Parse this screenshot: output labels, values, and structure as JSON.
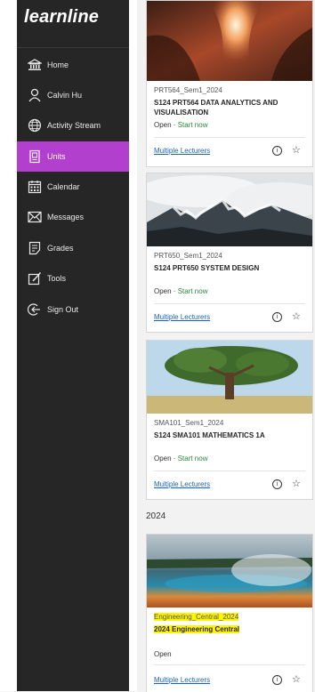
{
  "brand": {
    "logo_text": "learnline"
  },
  "sidebar": {
    "items": [
      {
        "label": "Home",
        "icon": "bank-icon"
      },
      {
        "label": "Calvin Hu",
        "icon": "user-icon"
      },
      {
        "label": "Activity Stream",
        "icon": "globe-icon"
      },
      {
        "label": "Units",
        "icon": "units-icon",
        "active": true
      },
      {
        "label": "Calendar",
        "icon": "calendar-icon"
      },
      {
        "label": "Messages",
        "icon": "mail-icon"
      },
      {
        "label": "Grades",
        "icon": "grades-icon"
      },
      {
        "label": "Tools",
        "icon": "tools-icon"
      },
      {
        "label": "Sign Out",
        "icon": "sign-out-icon"
      }
    ]
  },
  "units": [
    {
      "code": "PRT564_Sem1_2024",
      "title": "S124 PRT564 DATA ANALYTICS AND VISUALISATION",
      "status": "Open",
      "status_sep": " · ",
      "start_label": "Start now",
      "lecturers": "Multiple Lecturers",
      "info_icon": "info-icon",
      "star_icon": "star-icon",
      "image": "canyon-image"
    },
    {
      "code": "PRT650_Sem1_2024",
      "title": "S124 PRT650 SYSTEM DESIGN",
      "status": "Open",
      "status_sep": " · ",
      "start_label": "Start now",
      "lecturers": "Multiple Lecturers",
      "info_icon": "info-icon",
      "star_icon": "star-icon",
      "image": "mountain-image"
    },
    {
      "code": "SMA101_Sem1_2024",
      "title": "S124 SMA101 MATHEMATICS 1A",
      "status": "Open",
      "status_sep": " · ",
      "start_label": "Start now",
      "lecturers": "Multiple Lecturers",
      "info_icon": "info-icon",
      "star_icon": "star-icon",
      "image": "tree-image"
    },
    {
      "code": "Engineering_Central_2024",
      "title": "2024 Engineering Central",
      "status": "Open",
      "lecturers": "Multiple Lecturers",
      "info_icon": "info-icon",
      "star_icon": "star-icon",
      "image": "hot-spring-image",
      "highlight_color": "#fff400"
    }
  ],
  "section_year": "2024",
  "colors": {
    "sidebar_bg": "#262626",
    "active_bg": "#b23fce",
    "link": "#1a63b8",
    "start": "#2a8a3a"
  }
}
